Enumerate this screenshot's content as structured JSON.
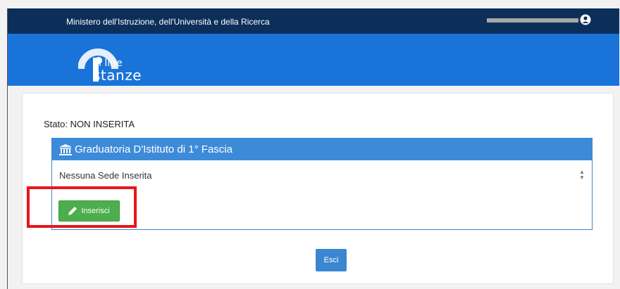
{
  "header": {
    "ministry": "Ministero dell'Istruzione, dell'Università e della Ricerca",
    "logo_line1": "n line",
    "logo_line2": "stanze"
  },
  "main": {
    "stato_label": "Stato: ",
    "stato_value": "NON INSERITA",
    "panel_title": "Graduatoria D'Istituto di 1° Fascia",
    "sede_text": "Nessuna Sede Inserita",
    "inserisci_label": "Inserisci",
    "esci_label": "Esci"
  },
  "icons": {
    "user": "user-icon",
    "bank": "bank-icon",
    "pencil": "pencil-icon",
    "spinner": "spinner-icon"
  },
  "colors": {
    "topbar": "#0c2f5a",
    "header": "#1a73d9",
    "panel_head": "#3d8bd8",
    "inserisci": "#4cae4c",
    "esci": "#3b86d1",
    "highlight": "#e8151c"
  }
}
